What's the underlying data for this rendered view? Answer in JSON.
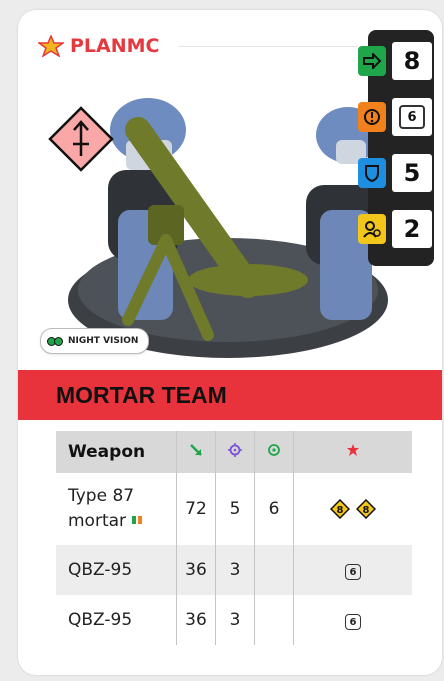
{
  "faction": {
    "name": "PLANMC"
  },
  "stats": {
    "move": "8",
    "defense_dice": "6",
    "armor": "5",
    "command": "2"
  },
  "badge": {
    "label": "NIGHT VISION"
  },
  "unit": {
    "name": "MORTAR TEAM"
  },
  "weapons_table": {
    "header": "Weapon",
    "rows": [
      {
        "name_line1": "Type 87",
        "name_line2": "mortar",
        "range": "72",
        "attacks": "5",
        "skill": "6",
        "special": [
          "8",
          "8"
        ]
      },
      {
        "name": "QBZ-95",
        "range": "36",
        "attacks": "3",
        "skill": "",
        "special_die": "6"
      },
      {
        "name": "QBZ-95",
        "range": "36",
        "attacks": "3",
        "skill": "",
        "special_die": "6"
      }
    ]
  },
  "colors": {
    "accent_red": "#e9333c",
    "move_green": "#1fa64a",
    "orange": "#f0811c",
    "blue": "#1e8fe0",
    "yellow": "#f2c61a"
  },
  "icons": [
    "faction-star-icon",
    "unit-type-marker-icon",
    "move-arrow-icon",
    "defense-icon",
    "shield-icon",
    "command-icon",
    "range-icon",
    "attacks-icon",
    "skill-icon",
    "special-icon"
  ]
}
